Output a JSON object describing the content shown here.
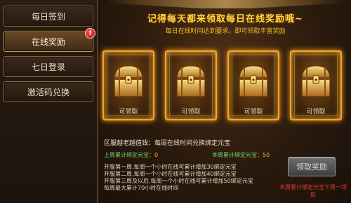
{
  "sidebar": {
    "items": [
      {
        "label": "每日签到",
        "active": false,
        "badge": ""
      },
      {
        "label": "在线奖励",
        "active": true,
        "badge": "!"
      },
      {
        "label": "七日登录",
        "active": false,
        "badge": ""
      },
      {
        "label": "激活码兑换",
        "active": false,
        "badge": ""
      }
    ]
  },
  "main": {
    "headline": "记得每天都来领取每日在线奖励哦~",
    "subline": "每日在线时间达到要求，即可领取丰富奖励",
    "chests": [
      {
        "label": "可领取",
        "icon": "treasure-chest-icon"
      },
      {
        "label": "可领取",
        "icon": "treasure-chest-icon"
      },
      {
        "label": "可领取",
        "icon": "treasure-chest-icon"
      },
      {
        "label": "可领取",
        "icon": "treasure-chest-icon"
      }
    ],
    "info_title": "区服越老越值钱：每周在线时间兑换绑定元宝",
    "last_week_label": "上周累计绑定元宝：",
    "last_week_value": "0",
    "this_week_label": "本周累计绑定元宝：",
    "this_week_value": "50",
    "rules": [
      "开服第一周,每周一个小时在线可累计增加30绑定元宝",
      "开服第二周,每周一个小时在线可累计增加40绑定元宝",
      "开服第三周及以后,每周一个小时在线可累计增加50绑定元宝",
      "每周最大累计70小时在线时间"
    ],
    "claim_button": "领取奖励",
    "claim_hint": "本周累计绑定元宝下周一领取"
  },
  "colors": {
    "accent_gold": "#ffd640",
    "card_glow": "#f1a727",
    "green_label": "#6fd45e",
    "hint_red": "#e03a2a"
  }
}
